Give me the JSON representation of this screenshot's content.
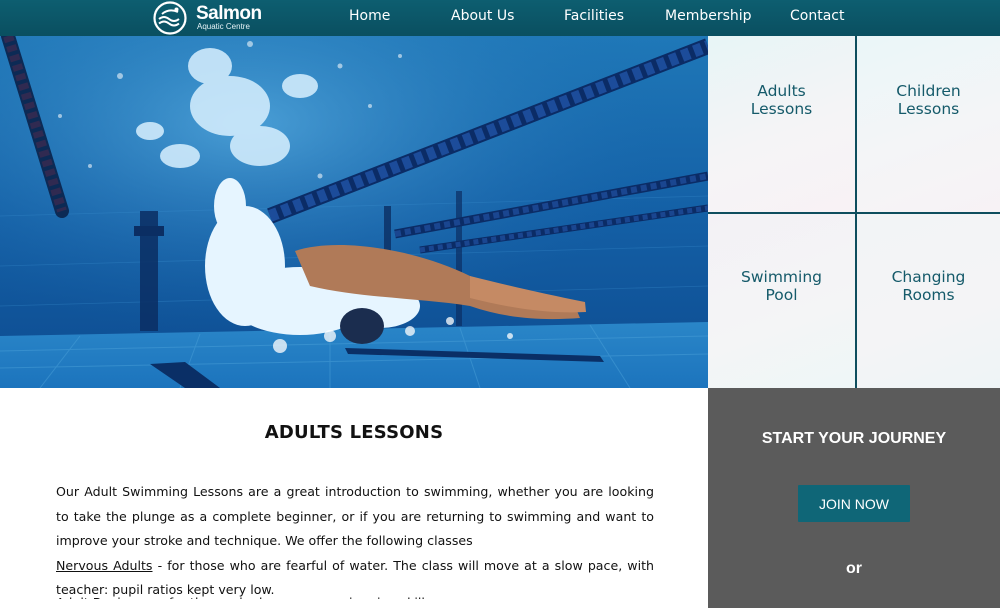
{
  "brand": {
    "name": "Salmon",
    "subtitle": "Aquatic Centre",
    "icon": "salmon-logo-icon"
  },
  "nav": {
    "items": [
      {
        "label": "Home"
      },
      {
        "label": "About Us"
      },
      {
        "label": "Facilities"
      },
      {
        "label": "Membership"
      },
      {
        "label": "Contact"
      }
    ]
  },
  "tiles": [
    {
      "label": "Adults\nLessons"
    },
    {
      "label": "Children\nLessons"
    },
    {
      "label": "Swimming\nPool"
    },
    {
      "label": "Changing\nRooms"
    }
  ],
  "main": {
    "title": "ADULTS LESSONS",
    "intro": "Our Adult Swimming Lessons are a great introduction to swimming, whether you are looking to take the plunge as a complete beginner, or if you are returning to swimming and want to improve your stroke and technique. We offer the following classes",
    "nervous_link": "Nervous Adults",
    "nervous_text": " - for those who are fearful of water. The class will move at a slow pace, with teacher: pupil ratios kept very low.",
    "next_line_partial": "Adult Beginners - for those who have some swimming skills"
  },
  "panel": {
    "title": "START YOUR JOURNEY",
    "button": "JOIN NOW",
    "or": "or"
  },
  "colors": {
    "header": "#0d5e70",
    "tile_text": "#155a6a",
    "tile_border": "#0e4e5e",
    "panel_bg": "#5b5b5b",
    "button_bg": "#0f6677"
  }
}
